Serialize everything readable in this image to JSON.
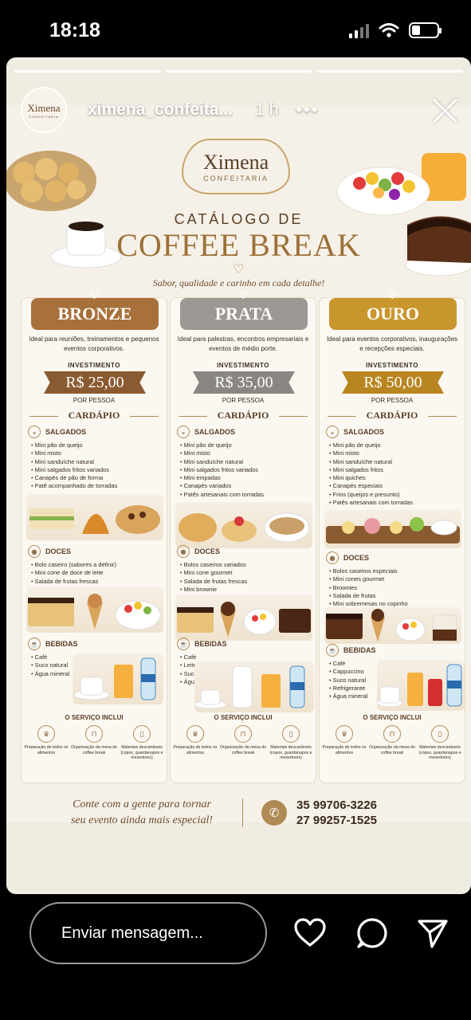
{
  "status_bar": {
    "time": "18:18"
  },
  "story": {
    "username": "ximena_confeita...",
    "time_ago": "1 h",
    "more": "•••",
    "avatar_text": "Ximena",
    "avatar_sub": "CONFEITARIA"
  },
  "flyer": {
    "logo_title": "Ximena",
    "logo_sub": "CONFEITARIA",
    "catalog_line1": "CATÁLOGO DE",
    "catalog_line2": "COFFEE BREAK",
    "tagline": "Sabor, qualidade e carinho em cada detalhe!",
    "packages": [
      {
        "name": "BRONZE",
        "description": "Ideal para reuniões, treinamentos e pequenos eventos corporativos.",
        "investment_label": "INVESTIMENTO",
        "price": "R$ 25,00",
        "per_person": "POR PESSOA",
        "menu_label": "CARDÁPIO",
        "salgados_label": "SALGADOS",
        "salgados": [
          "Mini pão de queijo",
          "Mini misto",
          "Mini sanduíche natural",
          "Mini salgados fritos variados",
          "Canapés de pão de forma",
          "Patê acompanhado de torradas"
        ],
        "doces_label": "DOCES",
        "doces": [
          "Bolo caseiro (sabores a definir)",
          "Mini cone de doce de leite",
          "Salada de frutas frescas"
        ],
        "bebidas_label": "BEBIDAS",
        "bebidas": [
          "Café",
          "Suco natural",
          "Água mineral"
        ]
      },
      {
        "name": "PRATA",
        "description": "Ideal para palestras, encontros empresariais e eventos de médio porte.",
        "investment_label": "INVESTIMENTO",
        "price": "R$ 35,00",
        "per_person": "POR PESSOA",
        "menu_label": "CARDÁPIO",
        "salgados_label": "SALGADOS",
        "salgados": [
          "Mini pão de queijo",
          "Mini misto",
          "Mini sanduíche natural",
          "Mini salgados fritos variados",
          "Mini empadas",
          "Canapés variados",
          "Patês artesanais com torradas"
        ],
        "doces_label": "DOCES",
        "doces": [
          "Bolos caseiros variados",
          "Mini cone gourmet",
          "Salada de frutas frescas",
          "Mini brownie"
        ],
        "bebidas_label": "BEBIDAS",
        "bebidas": [
          "Café",
          "Leite",
          "Suco natural",
          "Água mineral"
        ]
      },
      {
        "name": "OURO",
        "description": "Ideal para eventos corporativos, inaugurações e recepções especiais.",
        "investment_label": "INVESTIMENTO",
        "price": "R$ 50,00",
        "per_person": "POR PESSOA",
        "menu_label": "CARDÁPIO",
        "salgados_label": "SALGADOS",
        "salgados": [
          "Mini pão de queijo",
          "Mini misto",
          "Mini sanduíche natural",
          "Mini salgados fritos",
          "Mini quiches",
          "Canapés especiais",
          "Frios (queijos e presunto)",
          "Patês artesanais com torradas"
        ],
        "doces_label": "DOCES",
        "doces": [
          "Bolos caseiros especiais",
          "Mini cones gourmet",
          "Brownies",
          "Salada de frutas",
          "Mini sobremesas no copinho"
        ],
        "bebidas_label": "BEBIDAS",
        "bebidas": [
          "Café",
          "Cappuccino",
          "Suco natural",
          "Refrigerante",
          "Água mineral"
        ]
      }
    ],
    "service_label": "O SERVIÇO INCLUI",
    "services": [
      "Preparação de todos os alimentos",
      "Organização da mesa do coffee break",
      "Materiais descartáveis (copos, guardanapos e mexedores)"
    ],
    "footer_text_1": "Conte com a gente para tornar",
    "footer_text_2": "seu evento ainda mais especial!",
    "phone_1": "35 99706-3226",
    "phone_2": "27 99257-1525"
  },
  "bottom_bar": {
    "message_placeholder": "Enviar mensagem...",
    "icons": [
      "heart-icon",
      "comment-icon",
      "send-icon"
    ]
  },
  "colors": {
    "bronze": "#a8703a",
    "prata": "#9c9893",
    "ouro": "#c9962e",
    "gold_text": "#9c7038"
  }
}
